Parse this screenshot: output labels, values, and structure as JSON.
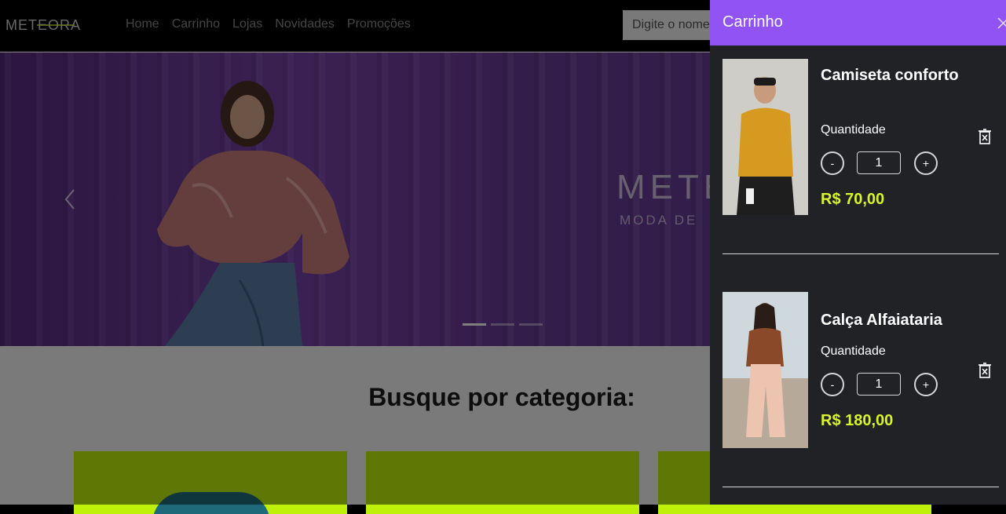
{
  "navbar": {
    "logo_text": "METEORA",
    "links": [
      "Home",
      "Carrinho",
      "Lojas",
      "Novidades",
      "Promoções"
    ],
    "search_placeholder": "Digite o nome"
  },
  "hero": {
    "brand_text": "METEORA",
    "tagline": "MODA DE",
    "slide_count": 3,
    "active_slide": 1
  },
  "categories": {
    "title": "Busque por categoria:"
  },
  "cart": {
    "title": "Carrinho",
    "items": [
      {
        "name": "Camiseta conforto",
        "qty_label": "Quantidade",
        "qty": "1",
        "minus": "-",
        "plus": "+",
        "price": "R$ 70,00"
      },
      {
        "name": "Calça Alfaiataria",
        "qty_label": "Quantidade",
        "qty": "1",
        "minus": "-",
        "plus": "+",
        "price": "R$ 180,00"
      }
    ]
  },
  "colors": {
    "accent": "#9153f4",
    "price": "#d8f52a",
    "panel": "#202226",
    "category": "#bff00a"
  }
}
